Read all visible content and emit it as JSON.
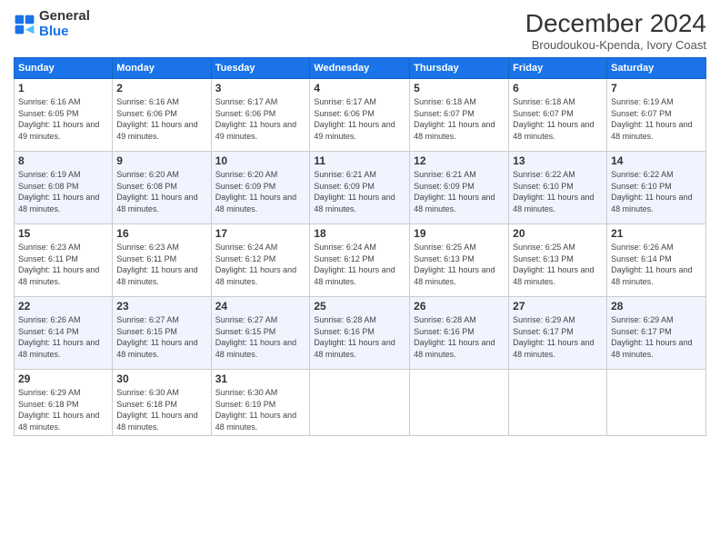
{
  "logo": {
    "line1": "General",
    "line2": "Blue"
  },
  "title": "December 2024",
  "subtitle": "Broudoukou-Kpenda, Ivory Coast",
  "weekdays": [
    "Sunday",
    "Monday",
    "Tuesday",
    "Wednesday",
    "Thursday",
    "Friday",
    "Saturday"
  ],
  "weeks": [
    [
      {
        "day": "1",
        "sunrise": "Sunrise: 6:16 AM",
        "sunset": "Sunset: 6:05 PM",
        "daylight": "Daylight: 11 hours and 49 minutes."
      },
      {
        "day": "2",
        "sunrise": "Sunrise: 6:16 AM",
        "sunset": "Sunset: 6:06 PM",
        "daylight": "Daylight: 11 hours and 49 minutes."
      },
      {
        "day": "3",
        "sunrise": "Sunrise: 6:17 AM",
        "sunset": "Sunset: 6:06 PM",
        "daylight": "Daylight: 11 hours and 49 minutes."
      },
      {
        "day": "4",
        "sunrise": "Sunrise: 6:17 AM",
        "sunset": "Sunset: 6:06 PM",
        "daylight": "Daylight: 11 hours and 49 minutes."
      },
      {
        "day": "5",
        "sunrise": "Sunrise: 6:18 AM",
        "sunset": "Sunset: 6:07 PM",
        "daylight": "Daylight: 11 hours and 48 minutes."
      },
      {
        "day": "6",
        "sunrise": "Sunrise: 6:18 AM",
        "sunset": "Sunset: 6:07 PM",
        "daylight": "Daylight: 11 hours and 48 minutes."
      },
      {
        "day": "7",
        "sunrise": "Sunrise: 6:19 AM",
        "sunset": "Sunset: 6:07 PM",
        "daylight": "Daylight: 11 hours and 48 minutes."
      }
    ],
    [
      {
        "day": "8",
        "sunrise": "Sunrise: 6:19 AM",
        "sunset": "Sunset: 6:08 PM",
        "daylight": "Daylight: 11 hours and 48 minutes."
      },
      {
        "day": "9",
        "sunrise": "Sunrise: 6:20 AM",
        "sunset": "Sunset: 6:08 PM",
        "daylight": "Daylight: 11 hours and 48 minutes."
      },
      {
        "day": "10",
        "sunrise": "Sunrise: 6:20 AM",
        "sunset": "Sunset: 6:09 PM",
        "daylight": "Daylight: 11 hours and 48 minutes."
      },
      {
        "day": "11",
        "sunrise": "Sunrise: 6:21 AM",
        "sunset": "Sunset: 6:09 PM",
        "daylight": "Daylight: 11 hours and 48 minutes."
      },
      {
        "day": "12",
        "sunrise": "Sunrise: 6:21 AM",
        "sunset": "Sunset: 6:09 PM",
        "daylight": "Daylight: 11 hours and 48 minutes."
      },
      {
        "day": "13",
        "sunrise": "Sunrise: 6:22 AM",
        "sunset": "Sunset: 6:10 PM",
        "daylight": "Daylight: 11 hours and 48 minutes."
      },
      {
        "day": "14",
        "sunrise": "Sunrise: 6:22 AM",
        "sunset": "Sunset: 6:10 PM",
        "daylight": "Daylight: 11 hours and 48 minutes."
      }
    ],
    [
      {
        "day": "15",
        "sunrise": "Sunrise: 6:23 AM",
        "sunset": "Sunset: 6:11 PM",
        "daylight": "Daylight: 11 hours and 48 minutes."
      },
      {
        "day": "16",
        "sunrise": "Sunrise: 6:23 AM",
        "sunset": "Sunset: 6:11 PM",
        "daylight": "Daylight: 11 hours and 48 minutes."
      },
      {
        "day": "17",
        "sunrise": "Sunrise: 6:24 AM",
        "sunset": "Sunset: 6:12 PM",
        "daylight": "Daylight: 11 hours and 48 minutes."
      },
      {
        "day": "18",
        "sunrise": "Sunrise: 6:24 AM",
        "sunset": "Sunset: 6:12 PM",
        "daylight": "Daylight: 11 hours and 48 minutes."
      },
      {
        "day": "19",
        "sunrise": "Sunrise: 6:25 AM",
        "sunset": "Sunset: 6:13 PM",
        "daylight": "Daylight: 11 hours and 48 minutes."
      },
      {
        "day": "20",
        "sunrise": "Sunrise: 6:25 AM",
        "sunset": "Sunset: 6:13 PM",
        "daylight": "Daylight: 11 hours and 48 minutes."
      },
      {
        "day": "21",
        "sunrise": "Sunrise: 6:26 AM",
        "sunset": "Sunset: 6:14 PM",
        "daylight": "Daylight: 11 hours and 48 minutes."
      }
    ],
    [
      {
        "day": "22",
        "sunrise": "Sunrise: 6:26 AM",
        "sunset": "Sunset: 6:14 PM",
        "daylight": "Daylight: 11 hours and 48 minutes."
      },
      {
        "day": "23",
        "sunrise": "Sunrise: 6:27 AM",
        "sunset": "Sunset: 6:15 PM",
        "daylight": "Daylight: 11 hours and 48 minutes."
      },
      {
        "day": "24",
        "sunrise": "Sunrise: 6:27 AM",
        "sunset": "Sunset: 6:15 PM",
        "daylight": "Daylight: 11 hours and 48 minutes."
      },
      {
        "day": "25",
        "sunrise": "Sunrise: 6:28 AM",
        "sunset": "Sunset: 6:16 PM",
        "daylight": "Daylight: 11 hours and 48 minutes."
      },
      {
        "day": "26",
        "sunrise": "Sunrise: 6:28 AM",
        "sunset": "Sunset: 6:16 PM",
        "daylight": "Daylight: 11 hours and 48 minutes."
      },
      {
        "day": "27",
        "sunrise": "Sunrise: 6:29 AM",
        "sunset": "Sunset: 6:17 PM",
        "daylight": "Daylight: 11 hours and 48 minutes."
      },
      {
        "day": "28",
        "sunrise": "Sunrise: 6:29 AM",
        "sunset": "Sunset: 6:17 PM",
        "daylight": "Daylight: 11 hours and 48 minutes."
      }
    ],
    [
      {
        "day": "29",
        "sunrise": "Sunrise: 6:29 AM",
        "sunset": "Sunset: 6:18 PM",
        "daylight": "Daylight: 11 hours and 48 minutes."
      },
      {
        "day": "30",
        "sunrise": "Sunrise: 6:30 AM",
        "sunset": "Sunset: 6:18 PM",
        "daylight": "Daylight: 11 hours and 48 minutes."
      },
      {
        "day": "31",
        "sunrise": "Sunrise: 6:30 AM",
        "sunset": "Sunset: 6:19 PM",
        "daylight": "Daylight: 11 hours and 48 minutes."
      },
      null,
      null,
      null,
      null
    ]
  ]
}
